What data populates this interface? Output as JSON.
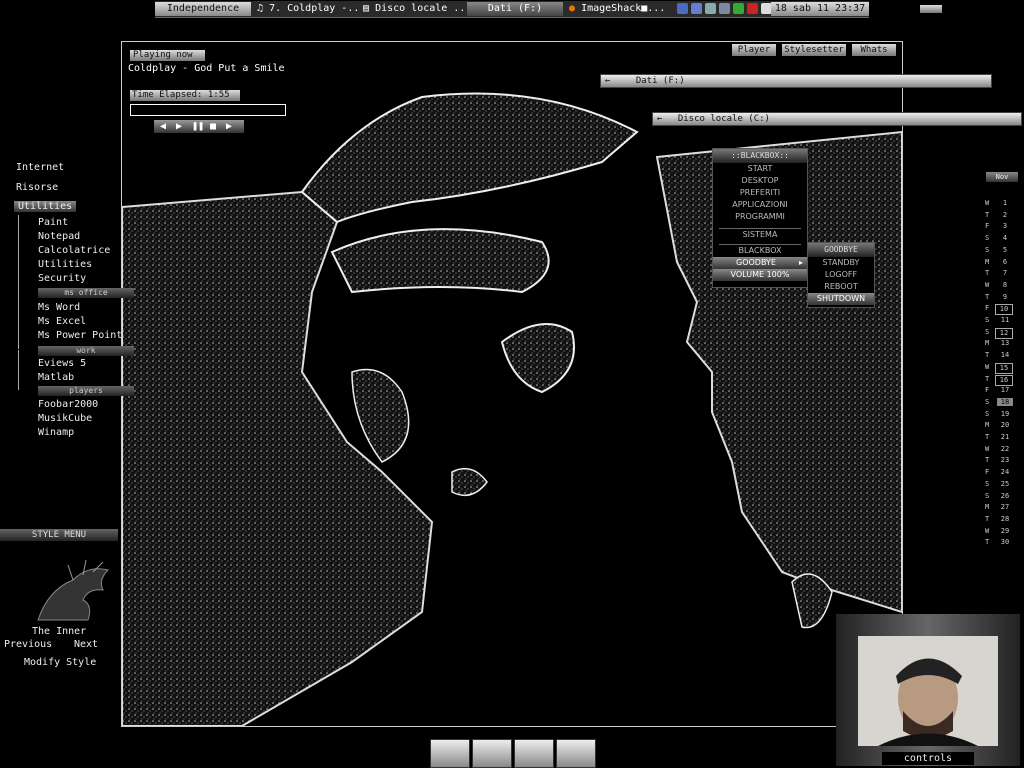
{
  "taskbar": {
    "workspace": "Independence",
    "tasks": [
      "7. Coldplay -...",
      "Disco locale ...",
      "Dati (F:)",
      "ImageShack■..."
    ],
    "clock": "18 sab 11  23:37"
  },
  "player": {
    "now_playing_label": "Playing now",
    "track": "Coldplay - God Put a Smile",
    "time_label": "Time Elapsed: 1:55",
    "progress": 0.0,
    "tabs": [
      "Player",
      "Stylesetter",
      "Whats"
    ]
  },
  "explorer_bars": {
    "dati": "Dati (F:)",
    "disco": "Disco locale (C:)"
  },
  "left_menu": {
    "top": [
      "Internet",
      "Risorse",
      "Utilities"
    ],
    "utilities": [
      "Paint",
      "Notepad",
      "Calcolatrice",
      "Utilities",
      "Security"
    ],
    "ms_office_header": "ms office",
    "ms_office": [
      "Ms Word",
      "Ms Excel",
      "Ms Power Point"
    ],
    "work_header": "work",
    "work": [
      "Eviews 5",
      "Matlab"
    ],
    "players_header": "players",
    "players": [
      "Foobar2000",
      "MusikCube",
      "Winamp"
    ]
  },
  "style_menu": {
    "header": "STYLE MENU",
    "style_name": "The Inner",
    "previous": "Previous",
    "next": "Next",
    "modify": "Modify Style"
  },
  "blackbox_menu": {
    "title": "::BLACKBOX::",
    "items": [
      "START",
      "DESKTOP",
      "PREFERITI",
      "APPLICAZIONI",
      "PROGRAMMI"
    ],
    "sistema": "SISTEMA",
    "blackbox": "BLACKBOX",
    "goodbye": "GOODBYE",
    "volume": "VOLUME 100%",
    "submenu_title": "GOODBYE",
    "submenu": [
      "STANDBY",
      "LOGOFF",
      "REBOOT",
      "SHUTDOWN"
    ]
  },
  "calendar": {
    "month": "Nov",
    "days": [
      [
        "W",
        "1"
      ],
      [
        "T",
        "2"
      ],
      [
        "F",
        "3"
      ],
      [
        "S",
        "4"
      ],
      [
        "S",
        "5"
      ],
      [
        "M",
        "6"
      ],
      [
        "T",
        "7"
      ],
      [
        "W",
        "8"
      ],
      [
        "T",
        "9"
      ],
      [
        "F",
        "10"
      ],
      [
        "S",
        "11"
      ],
      [
        "S",
        "12"
      ],
      [
        "M",
        "13"
      ],
      [
        "T",
        "14"
      ],
      [
        "W",
        "15"
      ],
      [
        "T",
        "16"
      ],
      [
        "F",
        "17"
      ],
      [
        "S",
        "18"
      ],
      [
        "S",
        "19"
      ],
      [
        "M",
        "20"
      ],
      [
        "T",
        "21"
      ],
      [
        "W",
        "22"
      ],
      [
        "T",
        "23"
      ],
      [
        "F",
        "24"
      ],
      [
        "S",
        "25"
      ],
      [
        "S",
        "26"
      ],
      [
        "M",
        "27"
      ],
      [
        "T",
        "28"
      ],
      [
        "W",
        "29"
      ],
      [
        "T",
        "30"
      ]
    ],
    "boxed": [
      "10",
      "12",
      "15",
      "16"
    ],
    "today": "18"
  },
  "webcam": {
    "label": "controls"
  },
  "colors": {
    "background": "#000000",
    "text": "#dddddd",
    "accent": "#ffffff"
  }
}
